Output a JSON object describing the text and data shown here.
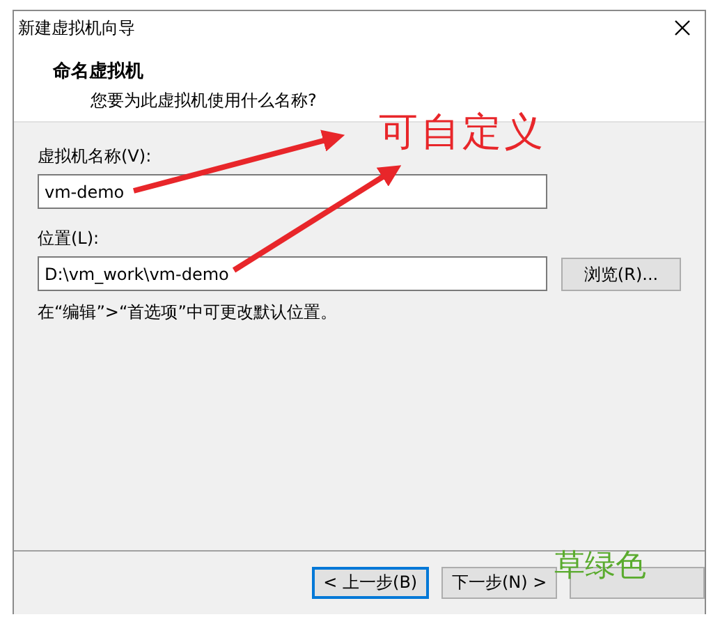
{
  "window": {
    "title": "新建虚拟机向导"
  },
  "header": {
    "title": "命名虚拟机",
    "subtitle": "您要为此虚拟机使用什么名称?"
  },
  "name_field": {
    "label": "虚拟机名称(V):",
    "value": "vm-demo"
  },
  "location_field": {
    "label": "位置(L):",
    "value": "D:\\vm_work\\vm-demo",
    "browse_button": "浏览(R)...",
    "hint": "在“编辑”>“首选项”中可更改默认位置。"
  },
  "buttons": [
    {
      "kind": "back",
      "label": "< 上一步(B)",
      "selected": true
    },
    {
      "kind": "next",
      "label": "下一步(N) >",
      "selected": false
    },
    {
      "kind": "covered",
      "selected": false
    }
  ],
  "annotations": {
    "custom_note": "可自定义",
    "color_note": "草绿色"
  }
}
